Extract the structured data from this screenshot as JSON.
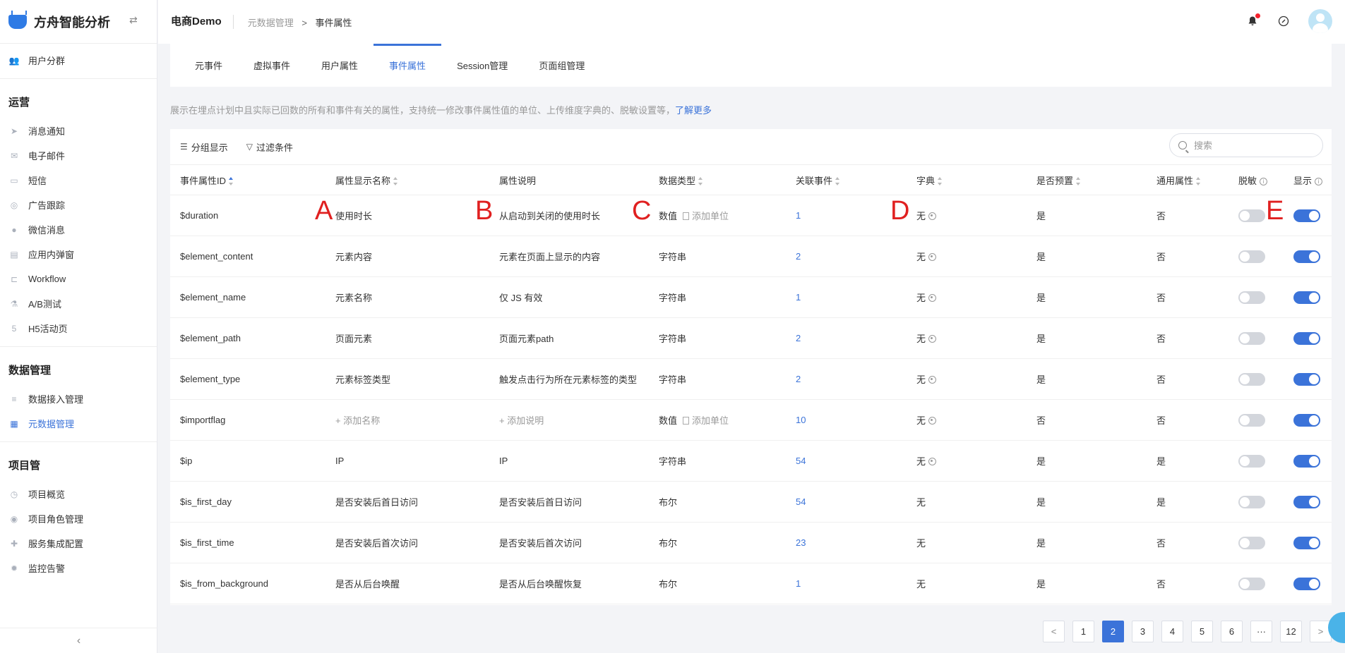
{
  "brand": {
    "title": "方舟智能分析",
    "toggle_icon": "swap-icon"
  },
  "sidebar": {
    "top_items": [
      {
        "label": "用户分群",
        "icon": "users-icon"
      }
    ],
    "groups": [
      {
        "title": "运营",
        "items": [
          {
            "label": "消息通知",
            "icon": "send-icon"
          },
          {
            "label": "电子邮件",
            "icon": "mail-icon"
          },
          {
            "label": "短信",
            "icon": "sms-icon"
          },
          {
            "label": "广告跟踪",
            "icon": "target-icon"
          },
          {
            "label": "微信消息",
            "icon": "wechat-icon"
          },
          {
            "label": "应用内弹窗",
            "icon": "popup-icon"
          },
          {
            "label": "Workflow",
            "icon": "workflow-icon"
          },
          {
            "label": "A/B测试",
            "icon": "flask-icon"
          },
          {
            "label": "H5活动页",
            "icon": "html5-icon"
          }
        ]
      },
      {
        "title": "数据管理",
        "items": [
          {
            "label": "数据接入管理",
            "icon": "database-icon"
          },
          {
            "label": "元数据管理",
            "icon": "metadata-icon",
            "active": true
          }
        ]
      },
      {
        "title": "项目管",
        "items": [
          {
            "label": "项目概览",
            "icon": "overview-icon"
          },
          {
            "label": "项目角色管理",
            "icon": "role-icon"
          },
          {
            "label": "服务集成配置",
            "icon": "puzzle-icon"
          },
          {
            "label": "监控告警",
            "icon": "alarm-icon"
          }
        ]
      }
    ]
  },
  "header": {
    "project": "电商Demo",
    "breadcrumb": {
      "parent": "元数据管理",
      "separator": ">",
      "current": "事件属性"
    }
  },
  "tabs": [
    {
      "label": "元事件"
    },
    {
      "label": "虚拟事件"
    },
    {
      "label": "用户属性"
    },
    {
      "label": "事件属性",
      "active": true
    },
    {
      "label": "Session管理"
    },
    {
      "label": "页面组管理"
    }
  ],
  "description": {
    "text": "展示在埋点计划中且实际已回数的所有和事件有关的属性，支持统一修改事件属性值的单位、上传维度字典的、脱敏设置等，",
    "link": "了解更多"
  },
  "toolbar": {
    "group_label": "分组显示",
    "filter_label": "过滤条件",
    "search_placeholder": "搜索"
  },
  "table": {
    "columns": {
      "id": "事件属性ID",
      "name": "属性显示名称",
      "desc": "属性说明",
      "type": "数据类型",
      "events": "关联事件",
      "dict": "字典",
      "preset": "是否预置",
      "common": "通用属性",
      "mask": "脱敏",
      "show": "显示"
    },
    "rows": [
      {
        "id": "$duration",
        "name": "使用时长",
        "desc": "从启动到关闭的使用时长",
        "type": "数值",
        "unit": "添加单位",
        "events": "1",
        "dict": "无",
        "dict_gear": true,
        "preset": "是",
        "common": "否",
        "mask": false,
        "show": true
      },
      {
        "id": "$element_content",
        "name": "元素内容",
        "desc": "元素在页面上显示的内容",
        "type": "字符串",
        "unit": "",
        "events": "2",
        "dict": "无",
        "dict_gear": true,
        "preset": "是",
        "common": "否",
        "mask": false,
        "show": true
      },
      {
        "id": "$element_name",
        "name": "元素名称",
        "desc": "仅 JS 有效",
        "type": "字符串",
        "unit": "",
        "events": "1",
        "dict": "无",
        "dict_gear": true,
        "preset": "是",
        "common": "否",
        "mask": false,
        "show": true
      },
      {
        "id": "$element_path",
        "name": "页面元素",
        "desc": "页面元素path",
        "type": "字符串",
        "unit": "",
        "events": "2",
        "dict": "无",
        "dict_gear": true,
        "preset": "是",
        "common": "否",
        "mask": false,
        "show": true
      },
      {
        "id": "$element_type",
        "name": "元素标签类型",
        "desc": "触发点击行为所在元素标签的类型",
        "type": "字符串",
        "unit": "",
        "events": "2",
        "dict": "无",
        "dict_gear": true,
        "preset": "是",
        "common": "否",
        "mask": false,
        "show": true
      },
      {
        "id": "$importflag",
        "name": "+ 添加名称",
        "name_placeholder": true,
        "desc": "+ 添加说明",
        "desc_placeholder": true,
        "type": "数值",
        "unit": "添加单位",
        "events": "10",
        "dict": "无",
        "dict_gear": true,
        "preset": "否",
        "common": "否",
        "mask": false,
        "show": true
      },
      {
        "id": "$ip",
        "name": "IP",
        "desc": "IP",
        "type": "字符串",
        "unit": "",
        "events": "54",
        "dict": "无",
        "dict_gear": true,
        "preset": "是",
        "common": "是",
        "mask": false,
        "show": true
      },
      {
        "id": "$is_first_day",
        "name": "是否安装后首日访问",
        "desc": "是否安装后首日访问",
        "type": "布尔",
        "unit": "",
        "events": "54",
        "dict": "无",
        "dict_gear": false,
        "preset": "是",
        "common": "是",
        "mask": false,
        "show": true
      },
      {
        "id": "$is_first_time",
        "name": "是否安装后首次访问",
        "desc": "是否安装后首次访问",
        "type": "布尔",
        "unit": "",
        "events": "23",
        "dict": "无",
        "dict_gear": false,
        "preset": "是",
        "common": "否",
        "mask": false,
        "show": true
      },
      {
        "id": "$is_from_background",
        "name": "是否从后台唤醒",
        "desc": "是否从后台唤醒恢复",
        "type": "布尔",
        "unit": "",
        "events": "1",
        "dict": "无",
        "dict_gear": false,
        "preset": "是",
        "common": "否",
        "mask": false,
        "show": true
      }
    ]
  },
  "annotations": [
    "A",
    "B",
    "C",
    "D",
    "E"
  ],
  "pagination": {
    "prev": "<",
    "pages": [
      "1",
      "2",
      "3",
      "4",
      "5",
      "6",
      "···",
      "12"
    ],
    "current": "2",
    "next": ">"
  },
  "colors": {
    "accent": "#3b73d9",
    "marker": "#e02020"
  }
}
